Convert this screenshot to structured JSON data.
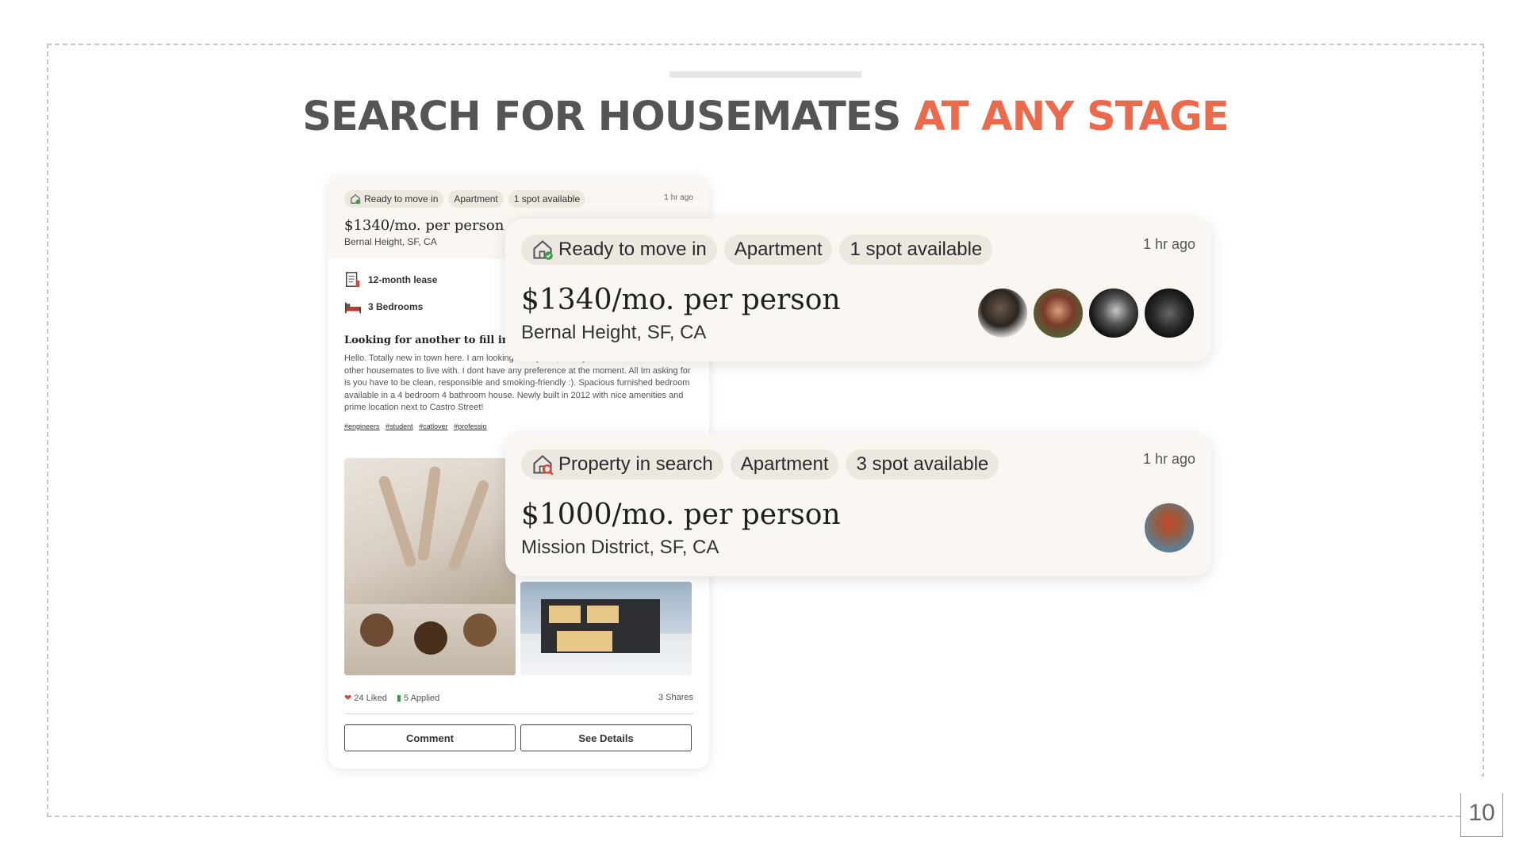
{
  "headline": {
    "main": "SEARCH FOR HOUSEMATES ",
    "accent": "AT ANY STAGE"
  },
  "colors": {
    "accent": "#ec6a4c",
    "headline": "#555555",
    "card_bg": "#faf7f2",
    "chip_bg": "#ece8e1"
  },
  "feed_card": {
    "chips": [
      "Ready to move in",
      "Apartment",
      "1 spot available"
    ],
    "time": "1 hr ago",
    "price": "$1340/mo. per person",
    "location": "Bernal Height, SF, CA",
    "features": [
      {
        "icon": "lease-document-icon",
        "label": "12-month lease"
      },
      {
        "icon": "bed-icon",
        "label": "3 Bedrooms"
      }
    ],
    "post_title": "Looking for another to fill in ou",
    "post_body": "Hello. Totally new in town here. I am looking for a place, ideally with 3 bedrooms and 2 other housemates to live with. I dont have any preference at the moment. All Im asking for is you have to be clean, responsible and smoking-friendly :). Spacious furnished bedroom available in a 4 bedroom 4 bathroom house. Newly built in 2012 with nice amenities and prime location next to Castro Street!",
    "tags": [
      "#engineers",
      "#student",
      "#catlover",
      "#professio"
    ],
    "liked": "24 Liked",
    "applied": "5 Applied",
    "shares": "3 Shares",
    "comment_label": "Comment",
    "details_label": "See Details"
  },
  "listings": [
    {
      "status_icon": "house-check-icon",
      "chips": [
        "Ready to move in",
        "Apartment",
        "1 spot available"
      ],
      "time": "1 hr ago",
      "price": "$1340/mo. per person",
      "location": "Bernal Height, SF, CA",
      "avatar_count": 4
    },
    {
      "status_icon": "house-search-icon",
      "chips": [
        "Property in search",
        "Apartment",
        "3 spot available"
      ],
      "time": "1 hr ago",
      "price": "$1000/mo. per person",
      "location": "Mission District, SF, CA",
      "avatar_count": 1
    }
  ],
  "page_number": "10"
}
